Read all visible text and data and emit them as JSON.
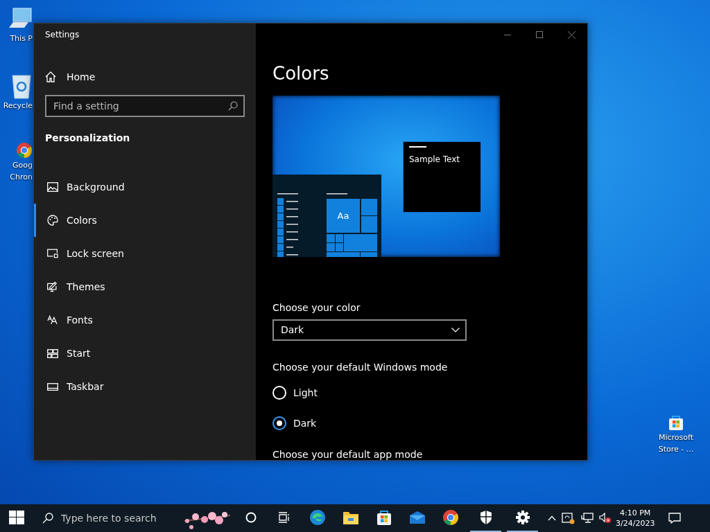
{
  "desktop_icons": [
    {
      "kind": "computer",
      "label_lines": [
        "This P"
      ]
    },
    {
      "kind": "recycle-bin",
      "label_lines": [
        "Recycle"
      ]
    },
    {
      "kind": "chrome",
      "label_lines": [
        "Goog",
        "Chron"
      ]
    }
  ],
  "desktop_icons_right": [
    {
      "kind": "store",
      "label_lines": [
        "Microsoft",
        "Store - ..."
      ]
    }
  ],
  "window": {
    "title": "Settings",
    "sidebar": {
      "home": "Home",
      "search": {
        "placeholder": "Find a setting"
      },
      "section": "Personalization",
      "items": [
        {
          "label": "Background",
          "selected": false
        },
        {
          "label": "Colors",
          "selected": true
        },
        {
          "label": "Lock screen",
          "selected": false
        },
        {
          "label": "Themes",
          "selected": false
        },
        {
          "label": "Fonts",
          "selected": false
        },
        {
          "label": "Start",
          "selected": false
        },
        {
          "label": "Taskbar",
          "selected": false
        }
      ]
    },
    "content": {
      "heading": "Colors",
      "preview": {
        "tile_text": "Aa",
        "sample_text": "Sample Text"
      },
      "color_label": "Choose your color",
      "color_value": "Dark",
      "windows_mode_label": "Choose your default Windows mode",
      "windows_mode_options": [
        {
          "label": "Light",
          "selected": false
        },
        {
          "label": "Dark",
          "selected": true
        }
      ],
      "app_mode_label": "Choose your default app mode"
    }
  },
  "taskbar": {
    "search": {
      "placeholder": "Type here to search"
    },
    "apps": [
      {
        "kind": "edge",
        "running": false
      },
      {
        "kind": "folder",
        "running": false
      },
      {
        "kind": "store",
        "running": false
      },
      {
        "kind": "mail",
        "running": false
      },
      {
        "kind": "chrome",
        "running": false
      },
      {
        "kind": "shield",
        "running": true
      },
      {
        "kind": "gear",
        "running": true
      }
    ],
    "time": "4:10 PM",
    "date": "3/24/2023"
  }
}
